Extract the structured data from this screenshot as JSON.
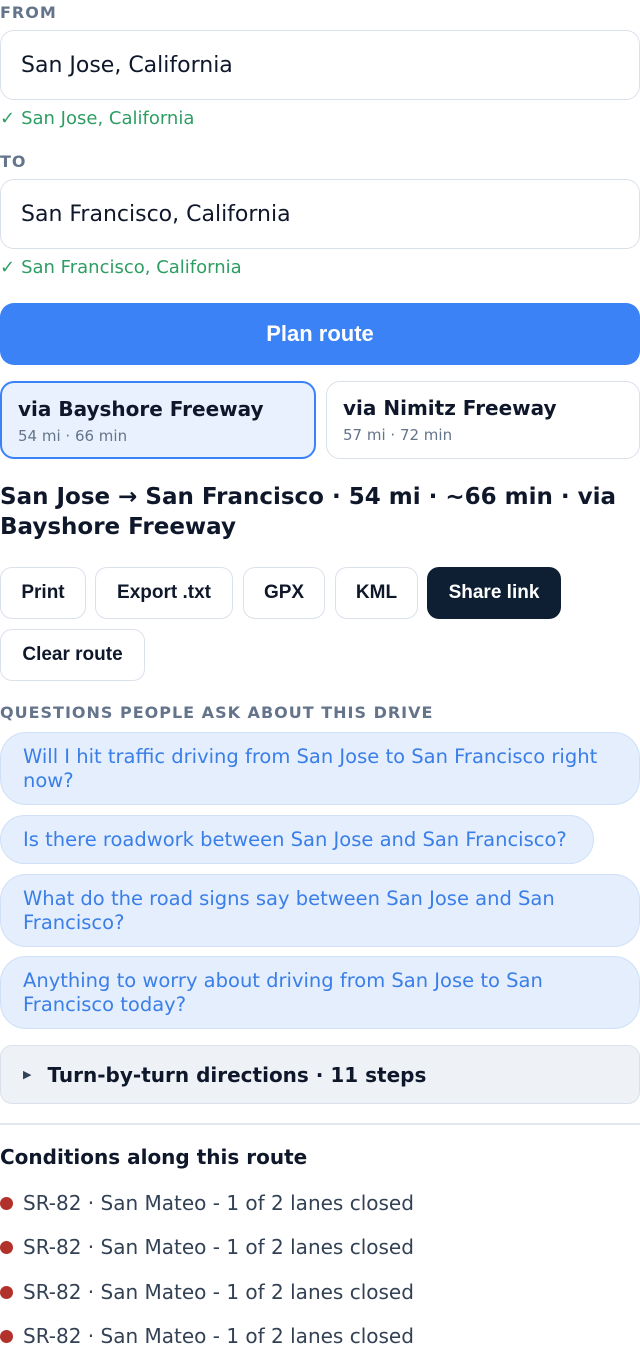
{
  "from": {
    "label": "FROM",
    "value": "San Jose, California",
    "confirmed": "San Jose, California"
  },
  "to": {
    "label": "TO",
    "value": "San Francisco, California",
    "confirmed": "San Francisco, California"
  },
  "check_icon": "✓",
  "plan_button": "Plan route",
  "routes": [
    {
      "name": "via Bayshore Freeway",
      "meta": "54 mi · 66 min",
      "selected": true
    },
    {
      "name": "via Nimitz Freeway",
      "meta": "57 mi · 72 min",
      "selected": false
    }
  ],
  "summary": "San Jose → San Francisco · 54 mi · ~66 min · via Bayshore Freeway",
  "actions": {
    "print": "Print",
    "export_txt": "Export .txt",
    "gpx": "GPX",
    "kml": "KML",
    "share_link": "Share link",
    "clear_route": "Clear route"
  },
  "questions": {
    "heading": "QUESTIONS PEOPLE ASK ABOUT THIS DRIVE",
    "items": [
      "Will I hit traffic driving from San Jose to San Francisco right now?",
      "Is there roadwork between San Jose and San Francisco?",
      "What do the road signs say between San Jose and San Francisco?",
      "Anything to worry about driving from San Jose to San Francisco today?"
    ]
  },
  "turn_by_turn": {
    "icon": "triangle-right-icon",
    "label": "Turn-by-turn directions · 11 steps"
  },
  "conditions": {
    "title": "Conditions along this route",
    "status_color": "#b3312b",
    "items": [
      "SR-82 · San Mateo - 1 of 2 lanes closed",
      "SR-82 · San Mateo - 1 of 2 lanes closed",
      "SR-82 · San Mateo - 1 of 2 lanes closed",
      "SR-82 · San Mateo - 1 of 2 lanes closed"
    ]
  }
}
